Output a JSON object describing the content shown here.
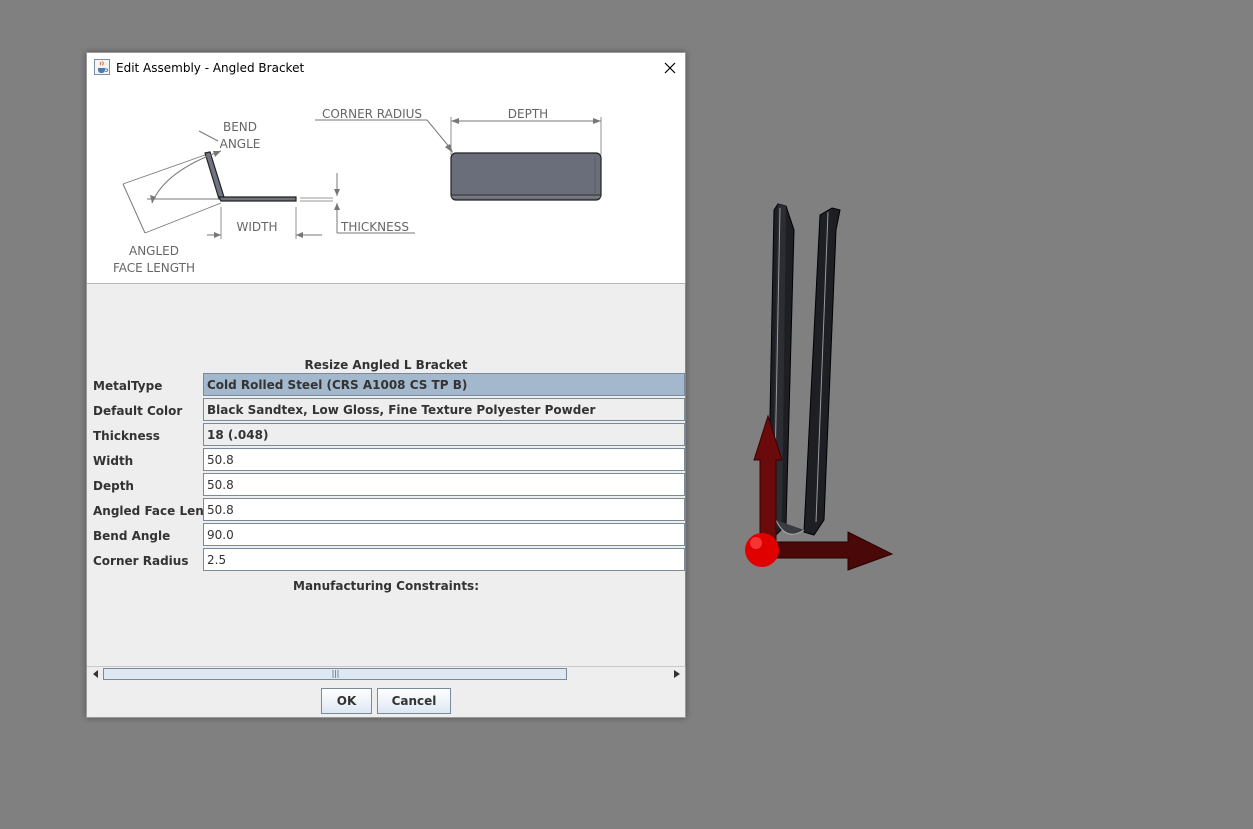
{
  "window": {
    "title": "Edit Assembly - Angled Bracket"
  },
  "diagram": {
    "bend_angle_line1": "BEND",
    "bend_angle_line2": "ANGLE",
    "corner_radius": "CORNER RADIUS",
    "depth": "DEPTH",
    "width": "WIDTH",
    "thickness": "THICKNESS",
    "angled_face_line1": "ANGLED",
    "angled_face_line2": "FACE LENGTH"
  },
  "form": {
    "header": "Resize Angled L Bracket",
    "fields": [
      {
        "label": "MetalType",
        "value": "Cold Rolled Steel (CRS A1008 CS TP B)"
      },
      {
        "label": "Default Color",
        "value": "Black Sandtex, Low Gloss, Fine Texture Polyester Powder"
      },
      {
        "label": "Thickness",
        "value": "18 (.048)"
      },
      {
        "label": "Width",
        "value": "50.8"
      },
      {
        "label": "Depth",
        "value": "50.8"
      },
      {
        "label": "Angled Face Length",
        "value": "50.8"
      },
      {
        "label": "Bend Angle",
        "value": "90.0"
      },
      {
        "label": "Corner Radius",
        "value": "2.5"
      }
    ],
    "constraints_label": "Manufacturing Constraints:"
  },
  "buttons": {
    "ok": "OK",
    "cancel": "Cancel"
  },
  "colors": {
    "background": "#808080",
    "selected_combo": "#a3b8cc",
    "axis_red": "#ff0000",
    "axis_dark_red": "#5a0a0a"
  }
}
